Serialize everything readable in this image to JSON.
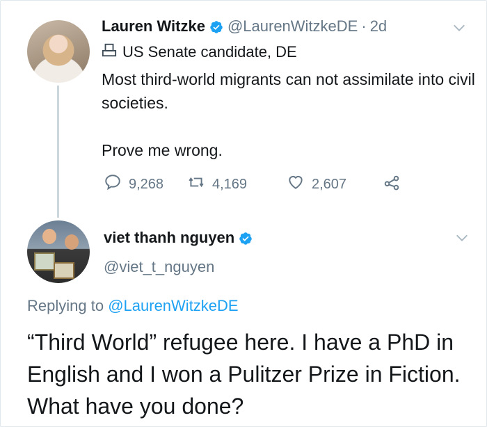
{
  "tweet1": {
    "author_name": "Lauren Witzke",
    "author_handle": "@LaurenWitzkeDE",
    "separator": "·",
    "time": "2d",
    "label": "US Senate candidate, DE",
    "text_line1": "Most third-world migrants can not assimilate into civil societies.",
    "text_line2": "Prove me wrong.",
    "reply_count": "9,268",
    "retweet_count": "4,169",
    "like_count": "2,607",
    "icons": [
      "verified-badge-icon",
      "ballot-box-icon",
      "chevron-down-icon",
      "reply-icon",
      "retweet-icon",
      "like-icon",
      "share-icon"
    ]
  },
  "tweet2": {
    "author_name": "viet thanh nguyen",
    "author_handle": "@viet_t_nguyen",
    "replying_prefix": "Replying to",
    "replying_handle": "@LaurenWitzkeDE",
    "text": "“Third World” refugee here. I have a PhD in English and I won a Pulitzer Prize in Fiction. What have you done?"
  },
  "colors": {
    "text": "#14171a",
    "secondary": "#657786",
    "link": "#1da1f2",
    "verified": "#1da1f2",
    "thread_line": "#ccd6dd"
  }
}
